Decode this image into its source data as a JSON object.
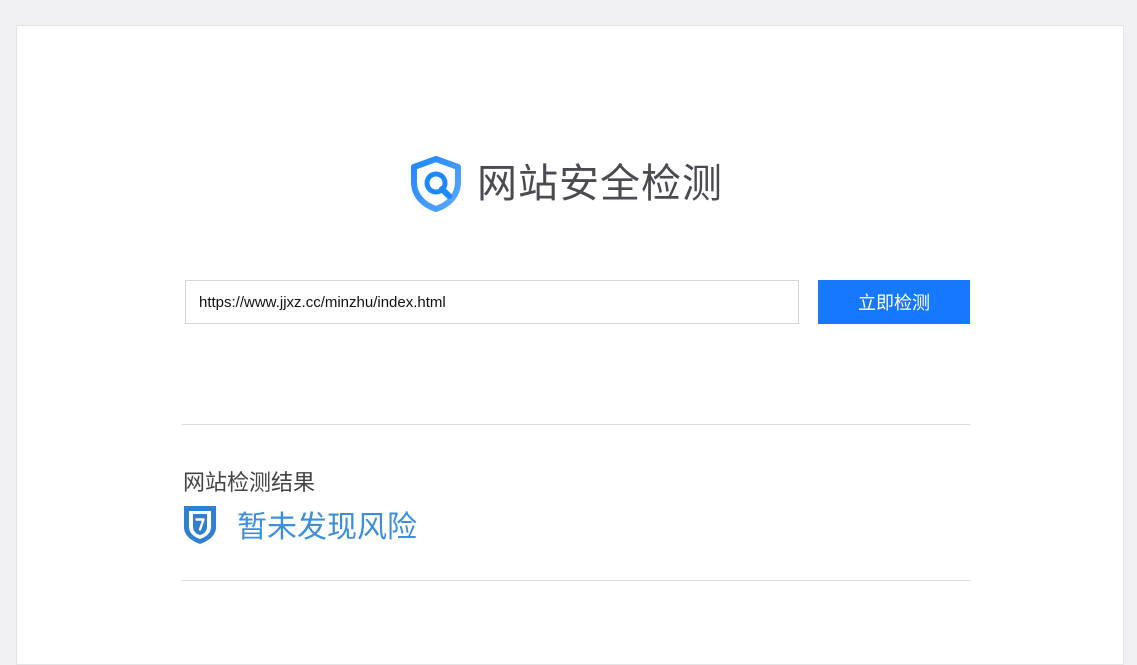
{
  "header": {
    "title": "网站安全检测",
    "logo_icon": "shield-search-icon"
  },
  "search": {
    "value": "https://www.jjxz.cc/minzhu/index.html",
    "button_label": "立即检测"
  },
  "result": {
    "heading": "网站检测结果",
    "status_text": "暂未发现风险",
    "status_icon": "shield-question-icon"
  },
  "colors": {
    "accent": "#1677ff",
    "status": "#3b8fdd",
    "background": "#f0f0f4"
  }
}
